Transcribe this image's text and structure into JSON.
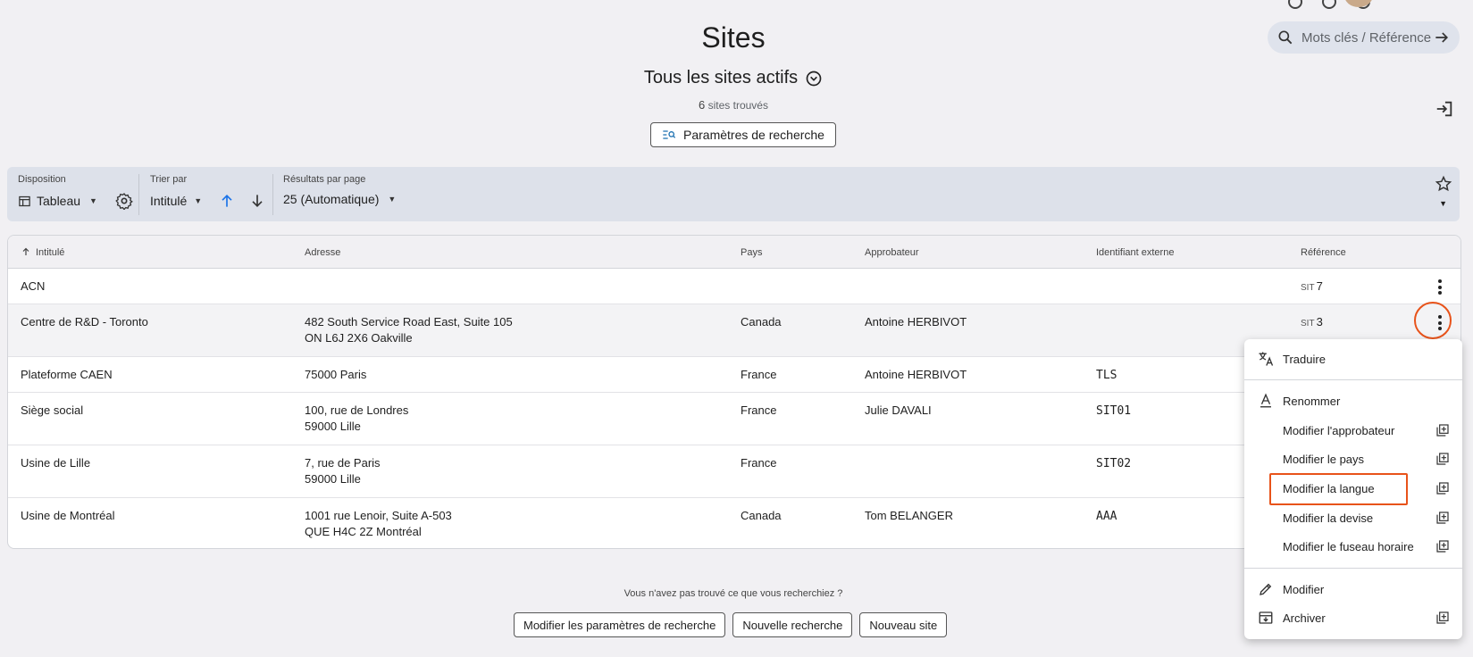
{
  "header": {
    "title": "Sites",
    "subtitle": "Tous les sites actifs",
    "count_number": "6",
    "count_text": "sites trouvés",
    "search_params_button": "Paramètres de recherche"
  },
  "search": {
    "placeholder": "Mots clés / Référence"
  },
  "toolbar": {
    "layout_label": "Disposition",
    "layout_value": "Tableau",
    "sort_label": "Trier par",
    "sort_value": "Intitulé",
    "results_label": "Résultats par page",
    "results_value": "25 (Automatique)"
  },
  "table": {
    "columns": [
      "Intitulé",
      "Adresse",
      "Pays",
      "Approbateur",
      "Identifiant externe",
      "Référence"
    ],
    "rows": [
      {
        "name": "ACN",
        "addr1": "",
        "addr2": "",
        "country": "",
        "approver": "",
        "ext_id": "",
        "ref_prefix": "SIT",
        "ref_num": "7"
      },
      {
        "name": "Centre de R&D - Toronto",
        "addr1": "482 South Service Road East, Suite 105",
        "addr2": "ON L6J 2X6 Oakville",
        "country": "Canada",
        "approver": "Antoine HERBIVOT",
        "ext_id": "",
        "ref_prefix": "SIT",
        "ref_num": "3"
      },
      {
        "name": "Plateforme CAEN",
        "addr1": "75000 Paris",
        "addr2": "",
        "country": "France",
        "approver": "Antoine HERBIVOT",
        "ext_id": "TLS",
        "ref_prefix": "",
        "ref_num": ""
      },
      {
        "name": "Siège social",
        "addr1": "100, rue de Londres",
        "addr2": "59000 Lille",
        "country": "France",
        "approver": "Julie DAVALI",
        "ext_id": "SIT01",
        "ref_prefix": "",
        "ref_num": ""
      },
      {
        "name": "Usine de Lille",
        "addr1": "7, rue de Paris",
        "addr2": "59000 Lille",
        "country": "France",
        "approver": "",
        "ext_id": "SIT02",
        "ref_prefix": "",
        "ref_num": ""
      },
      {
        "name": "Usine de Montréal",
        "addr1": "1001 rue Lenoir, Suite A-503",
        "addr2": "QUE H4C 2Z Montréal",
        "country": "Canada",
        "approver": "Tom BELANGER",
        "ext_id": "AAA",
        "ref_prefix": "",
        "ref_num": ""
      }
    ]
  },
  "menu": {
    "translate": "Traduire",
    "rename": "Renommer",
    "edit_approver": "Modifier l'approbateur",
    "edit_country": "Modifier le pays",
    "edit_language": "Modifier la langue",
    "edit_currency": "Modifier la devise",
    "edit_timezone": "Modifier le fuseau horaire",
    "edit": "Modifier",
    "archive": "Archiver"
  },
  "footer": {
    "not_found": "Vous n'avez pas trouvé ce que vous recherchiez ?",
    "btn_edit_params": "Modifier les paramètres de recherche",
    "btn_new_search": "Nouvelle recherche",
    "btn_new_site": "Nouveau site"
  },
  "colors": {
    "accent": "#1a73e8",
    "highlight": "#e8531a",
    "background": "#f1f0f3",
    "toolbar": "#dde1ea"
  }
}
